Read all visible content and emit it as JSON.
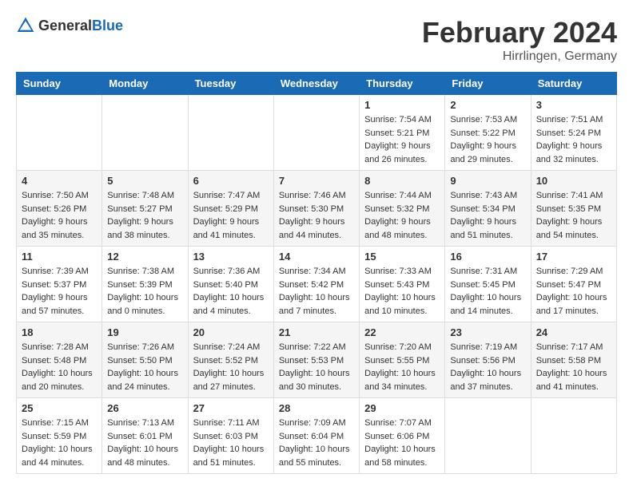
{
  "header": {
    "logo_general": "General",
    "logo_blue": "Blue",
    "month_title": "February 2024",
    "location": "Hirrlingen, Germany"
  },
  "calendar": {
    "days_of_week": [
      "Sunday",
      "Monday",
      "Tuesday",
      "Wednesday",
      "Thursday",
      "Friday",
      "Saturday"
    ],
    "weeks": [
      [
        {
          "day": "",
          "info": ""
        },
        {
          "day": "",
          "info": ""
        },
        {
          "day": "",
          "info": ""
        },
        {
          "day": "",
          "info": ""
        },
        {
          "day": "1",
          "info": "Sunrise: 7:54 AM\nSunset: 5:21 PM\nDaylight: 9 hours\nand 26 minutes."
        },
        {
          "day": "2",
          "info": "Sunrise: 7:53 AM\nSunset: 5:22 PM\nDaylight: 9 hours\nand 29 minutes."
        },
        {
          "day": "3",
          "info": "Sunrise: 7:51 AM\nSunset: 5:24 PM\nDaylight: 9 hours\nand 32 minutes."
        }
      ],
      [
        {
          "day": "4",
          "info": "Sunrise: 7:50 AM\nSunset: 5:26 PM\nDaylight: 9 hours\nand 35 minutes."
        },
        {
          "day": "5",
          "info": "Sunrise: 7:48 AM\nSunset: 5:27 PM\nDaylight: 9 hours\nand 38 minutes."
        },
        {
          "day": "6",
          "info": "Sunrise: 7:47 AM\nSunset: 5:29 PM\nDaylight: 9 hours\nand 41 minutes."
        },
        {
          "day": "7",
          "info": "Sunrise: 7:46 AM\nSunset: 5:30 PM\nDaylight: 9 hours\nand 44 minutes."
        },
        {
          "day": "8",
          "info": "Sunrise: 7:44 AM\nSunset: 5:32 PM\nDaylight: 9 hours\nand 48 minutes."
        },
        {
          "day": "9",
          "info": "Sunrise: 7:43 AM\nSunset: 5:34 PM\nDaylight: 9 hours\nand 51 minutes."
        },
        {
          "day": "10",
          "info": "Sunrise: 7:41 AM\nSunset: 5:35 PM\nDaylight: 9 hours\nand 54 minutes."
        }
      ],
      [
        {
          "day": "11",
          "info": "Sunrise: 7:39 AM\nSunset: 5:37 PM\nDaylight: 9 hours\nand 57 minutes."
        },
        {
          "day": "12",
          "info": "Sunrise: 7:38 AM\nSunset: 5:39 PM\nDaylight: 10 hours\nand 0 minutes."
        },
        {
          "day": "13",
          "info": "Sunrise: 7:36 AM\nSunset: 5:40 PM\nDaylight: 10 hours\nand 4 minutes."
        },
        {
          "day": "14",
          "info": "Sunrise: 7:34 AM\nSunset: 5:42 PM\nDaylight: 10 hours\nand 7 minutes."
        },
        {
          "day": "15",
          "info": "Sunrise: 7:33 AM\nSunset: 5:43 PM\nDaylight: 10 hours\nand 10 minutes."
        },
        {
          "day": "16",
          "info": "Sunrise: 7:31 AM\nSunset: 5:45 PM\nDaylight: 10 hours\nand 14 minutes."
        },
        {
          "day": "17",
          "info": "Sunrise: 7:29 AM\nSunset: 5:47 PM\nDaylight: 10 hours\nand 17 minutes."
        }
      ],
      [
        {
          "day": "18",
          "info": "Sunrise: 7:28 AM\nSunset: 5:48 PM\nDaylight: 10 hours\nand 20 minutes."
        },
        {
          "day": "19",
          "info": "Sunrise: 7:26 AM\nSunset: 5:50 PM\nDaylight: 10 hours\nand 24 minutes."
        },
        {
          "day": "20",
          "info": "Sunrise: 7:24 AM\nSunset: 5:52 PM\nDaylight: 10 hours\nand 27 minutes."
        },
        {
          "day": "21",
          "info": "Sunrise: 7:22 AM\nSunset: 5:53 PM\nDaylight: 10 hours\nand 30 minutes."
        },
        {
          "day": "22",
          "info": "Sunrise: 7:20 AM\nSunset: 5:55 PM\nDaylight: 10 hours\nand 34 minutes."
        },
        {
          "day": "23",
          "info": "Sunrise: 7:19 AM\nSunset: 5:56 PM\nDaylight: 10 hours\nand 37 minutes."
        },
        {
          "day": "24",
          "info": "Sunrise: 7:17 AM\nSunset: 5:58 PM\nDaylight: 10 hours\nand 41 minutes."
        }
      ],
      [
        {
          "day": "25",
          "info": "Sunrise: 7:15 AM\nSunset: 5:59 PM\nDaylight: 10 hours\nand 44 minutes."
        },
        {
          "day": "26",
          "info": "Sunrise: 7:13 AM\nSunset: 6:01 PM\nDaylight: 10 hours\nand 48 minutes."
        },
        {
          "day": "27",
          "info": "Sunrise: 7:11 AM\nSunset: 6:03 PM\nDaylight: 10 hours\nand 51 minutes."
        },
        {
          "day": "28",
          "info": "Sunrise: 7:09 AM\nSunset: 6:04 PM\nDaylight: 10 hours\nand 55 minutes."
        },
        {
          "day": "29",
          "info": "Sunrise: 7:07 AM\nSunset: 6:06 PM\nDaylight: 10 hours\nand 58 minutes."
        },
        {
          "day": "",
          "info": ""
        },
        {
          "day": "",
          "info": ""
        }
      ]
    ]
  }
}
